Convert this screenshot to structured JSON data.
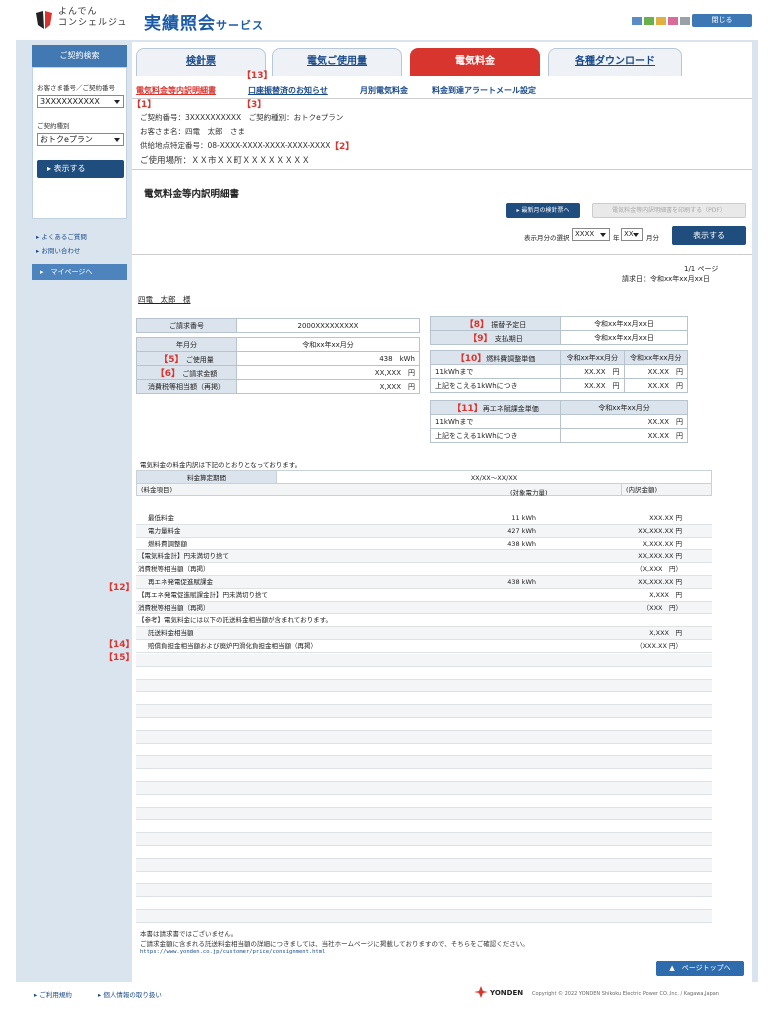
{
  "header": {
    "logo_small_1": "よんでん",
    "logo_small_2": "コンシェルジュ",
    "title": "実績照会",
    "title_sub": "サービス",
    "close_label": "閉じる",
    "squares": [
      "#5b8cc6",
      "#6ab04c",
      "#e0b040",
      "#d96a9a",
      "#9aa0a8"
    ]
  },
  "sidebar": {
    "head": "ご契約検索",
    "field1_label": "お客さま番号／ご契約番号",
    "field1_value": "3XXXXXXXXXX",
    "field2_label": "ご契約種別",
    "field2_value": "おトクeプラン",
    "show_btn": "表示する",
    "links": [
      "よくあるご質問",
      "お問い合わせ"
    ],
    "mypage": "マイページへ"
  },
  "tabs": [
    "検針票",
    "電気ご使用量",
    "電気料金",
    "各種ダウンロード"
  ],
  "subtabs": [
    "電気料金等内訳明細書",
    "口座振替済のお知らせ",
    "月別電気料金",
    "料金到達アラートメール設定"
  ],
  "markers": {
    "m1": "【1】",
    "m2": "【2】",
    "m3": "【3】",
    "m5": "【5】",
    "m6": "【6】",
    "m8": "【8】",
    "m9": "【9】",
    "m10": "【10】",
    "m11": "【11】",
    "m12": "【12】",
    "m13": "【13】",
    "m14": "【14】",
    "m15": "【15】"
  },
  "info": {
    "line1": "ご契約番号：3XXXXXXXXXX　ご契約種別：おトクeプラン",
    "line2": "お客さま名：四電　太郎　さま",
    "line3": "供給地点特定番号：08-XXXX-XXXX-XXXX-XXXX-XXXX",
    "line4": "ご使用場所：ＸＸ市ＸＸ町ＸＸＸＸＸＸＸＸ"
  },
  "section": {
    "title": "電気料金等内訳明細書",
    "latest_btn": "最新月の検針票へ",
    "print_btn": "電気料金等内訳明細書を印刷する（PDF）",
    "month_label": "表示月分の選択",
    "year_sel": "XXXX",
    "year_unit": "年",
    "month_sel": "XX",
    "month_unit": "月分",
    "show_btn": "表示する",
    "page": "1/1 ページ",
    "bill_date": "請求日：令和xx年xx月xx日",
    "customer": "四電　太郎　様"
  },
  "left_table": {
    "rows": [
      [
        "ご請求番号",
        "2000XXXXXXXXX"
      ],
      [
        "年月分",
        "令和xx年xx月分"
      ],
      [
        "ご使用量",
        "438　kWh"
      ],
      [
        "ご請求金額",
        "XX,XXX　円"
      ],
      [
        "消費税等相当額（再掲）",
        "X,XXX　円"
      ]
    ]
  },
  "right_table1": {
    "rows": [
      [
        "振替予定日",
        "令和xx年xx月xx日"
      ],
      [
        "支払期日",
        "令和xx年xx月xx日"
      ]
    ]
  },
  "right_table2": {
    "head": [
      "燃料費調整単価",
      "令和xx年xx月分",
      "令和xx年xx月分"
    ],
    "rows": [
      [
        "11kWhまで",
        "XX.XX　円",
        "XX.XX　円"
      ],
      [
        "上記をこえる1kWhにつき",
        "XX.XX　円",
        "XX.XX　円"
      ]
    ]
  },
  "right_table3": {
    "head": [
      "再エネ賦課金単価",
      "令和xx年xx月分"
    ],
    "rows": [
      [
        "11kWhまで",
        "XX.XX　円"
      ],
      [
        "上記をこえる1kWhにつき",
        "XX.XX　円"
      ]
    ]
  },
  "details": {
    "intro": "電気料金の料金内訳は下記のとおりとなっております。",
    "period_label": "料金算定期間",
    "period_value": "XX/XX～XX/XX",
    "col_head": [
      "(料金項目)",
      "(対象電力量)",
      "(内訳金額)"
    ],
    "rows": [
      [
        "最低料金",
        "11 kWh",
        "XXX.XX 円"
      ],
      [
        "電力量料金",
        "427 kWh",
        "XX,XXX.XX 円"
      ],
      [
        "燃料費調整額",
        "438 kWh",
        "X,XXX.XX 円"
      ],
      [
        "【電気料金計】円未満切り捨て",
        "",
        "XX,XXX.XX 円"
      ],
      [
        "消費税等相当額（再掲）",
        "",
        "（X,XXX　円）"
      ],
      [
        "再エネ発電促進賦課金",
        "438 kWh",
        "XX,XXX.XX 円"
      ],
      [
        "【再エネ発電促進賦課金計】円未満切り捨て",
        "",
        "X,XXX　円"
      ],
      [
        "消費税等相当額（再掲）",
        "",
        "（XXX　円）"
      ],
      [
        "【参考】電気料金には以下の託送料金相当額が含まれております。",
        "",
        ""
      ],
      [
        "託送料金相当額",
        "",
        "X,XXX　円"
      ],
      [
        "賠償負担金相当額および廃炉円滑化負担金相当額（再掲）",
        "",
        "（XXX.XX 円）"
      ]
    ]
  },
  "footer": {
    "note1": "本書は請求書ではございません。",
    "note2": "ご請求金額に含まれる託送料金相当額の詳細につきましては、当社ホームページに掲載しておりますので、そちらをご確認ください。",
    "url": "https://www.yonden.co.jp/customer/price/consignment.html",
    "pagetop": "ページトップへ",
    "terms": "ご利用規約",
    "privacy": "個人情報の取り扱い",
    "brand": "YONDEN",
    "copyright": "Copyright © 2022 YONDEN Shikoku Electric Power CO.,Inc. / Kagawa,Japan"
  }
}
